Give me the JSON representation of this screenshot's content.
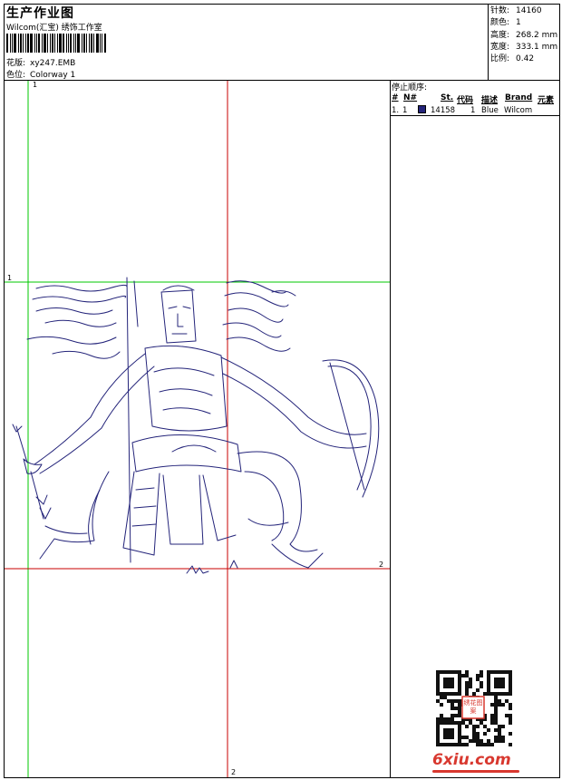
{
  "header": {
    "title": "生产作业图",
    "company": "Wilcom(汇宝) 绣饰工作室",
    "pattern_label": "花版:",
    "pattern_value": "xy247.EMB",
    "color_label": "色位:",
    "color_value": "Colorway 1"
  },
  "stats": [
    {
      "label": "针数:",
      "value": "14160"
    },
    {
      "label": "颜色:",
      "value": "1"
    },
    {
      "label": "高度:",
      "value": "268.2 mm"
    },
    {
      "label": "宽度:",
      "value": "333.1 mm"
    },
    {
      "label": "比例:",
      "value": "0.42"
    }
  ],
  "stop_sequence": {
    "title": "停止顺序:",
    "columns": [
      "#",
      "N#",
      "St.",
      "代码",
      "描述",
      "Brand",
      "元素"
    ],
    "rows": [
      {
        "num": "1.",
        "n": "1",
        "color": "#24247a",
        "stitches": "14158",
        "code": "1",
        "description": "Blue",
        "brand": "Wilcom",
        "element": ""
      }
    ]
  },
  "guides": {
    "top_label": "1",
    "left_label": "1",
    "right_label": "2",
    "bottom_label": "2"
  },
  "footer": {
    "stamp_text": "绣花图案",
    "logo": "6xiu.com"
  },
  "colors": {
    "thread": "#24247a",
    "guide_green": "#00c800",
    "guide_red": "#c80000",
    "logo_red": "#d8382f"
  }
}
